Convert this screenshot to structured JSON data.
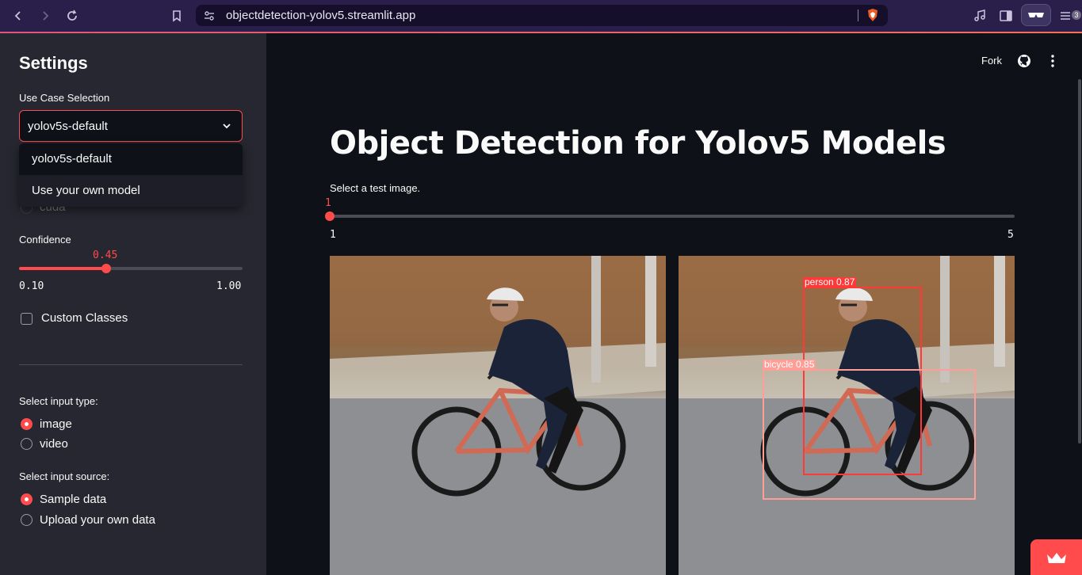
{
  "browser": {
    "url": "objectdetection-yolov5.streamlit.app",
    "shield_count": "3"
  },
  "sidebar": {
    "title": "Settings",
    "use_case_label": "Use Case Selection",
    "use_case_value": "yolov5s-default",
    "use_case_options": [
      "yolov5s-default",
      "Use your own model"
    ],
    "hidden_device_option": "cuda",
    "confidence_label": "Confidence",
    "confidence_value": "0.45",
    "confidence_min": "0.10",
    "confidence_max": "1.00",
    "confidence_fraction": 0.389,
    "custom_classes_label": "Custom Classes",
    "input_type_label": "Select input type:",
    "input_type_options": [
      "image",
      "video"
    ],
    "input_type_selected": "image",
    "input_source_label": "Select input source:",
    "input_source_options": [
      "Sample data",
      "Upload your own data"
    ],
    "input_source_selected": "Sample data"
  },
  "header": {
    "fork_label": "Fork"
  },
  "main": {
    "title": "Object Detection for Yolov5 Models",
    "test_image_label": "Select a test image.",
    "test_image_value": "1",
    "test_image_min": "1",
    "test_image_max": "5",
    "detections": [
      {
        "label": "person 0.87",
        "color": "#ff3838"
      },
      {
        "label": "bicycle 0.85",
        "color": "#ff9d97"
      }
    ]
  },
  "colors": {
    "accent": "#ff4b4b",
    "sidebar_bg": "#262730",
    "main_bg": "#0e1117",
    "browser_bg": "#2a1f4a"
  }
}
